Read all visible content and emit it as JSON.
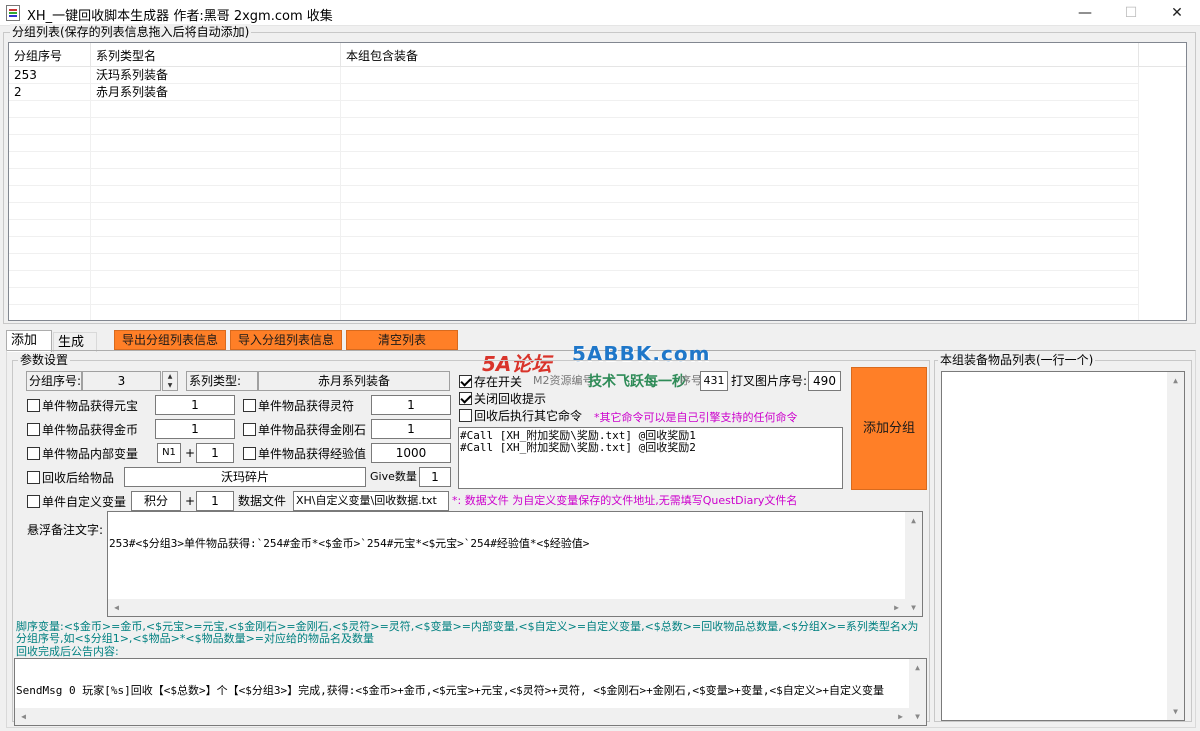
{
  "window": {
    "title": "XH_一键回收脚本生成器 作者:黑哥 2xgm.com 收集",
    "minimize": "—",
    "maximize": "☐",
    "close": "✕"
  },
  "group_list": {
    "title": "分组列表(保存的列表信息拖入后将自动添加)",
    "columns": [
      "分组序号",
      "系列类型名",
      "本组包含装备"
    ],
    "rows": [
      {
        "id": "253",
        "type": "沃玛系列装备",
        "items": ""
      },
      {
        "id": "2",
        "type": "赤月系列装备",
        "items": ""
      }
    ]
  },
  "tabs": [
    {
      "label": "添加"
    },
    {
      "label": "生成"
    }
  ],
  "toolbar": {
    "export": "导出分组列表信息",
    "import": "导入分组列表信息",
    "clear": "清空列表"
  },
  "watermark": {
    "logo": "5A论坛",
    "domain": "5ABBK.com",
    "slogan": "技术飞跃每一秒"
  },
  "params": {
    "title": "参数设置",
    "group_no_label": "分组序号:",
    "group_no_value": "3",
    "series_type_label": "系列类型:",
    "series_type_value": "赤月系列装备",
    "yuanbao": {
      "label": "单件物品获得元宝",
      "checked": false,
      "value": "1"
    },
    "lingfu": {
      "label": "单件物品获得灵符",
      "checked": false,
      "value": "1"
    },
    "gold": {
      "label": "单件物品获得金币",
      "checked": false,
      "value": "1"
    },
    "diamond": {
      "label": "单件物品获得金刚石",
      "checked": false,
      "value": "1"
    },
    "var": {
      "label": "单件物品内部变量",
      "checked": false,
      "var_name": "N1",
      "plus": "+",
      "value": "1"
    },
    "exp": {
      "label": "单件物品获得经验值",
      "checked": false,
      "value": "1000"
    },
    "give": {
      "label": "回收后给物品",
      "checked": false,
      "item": "沃玛碎片",
      "count_label": "Give数量",
      "count": "1"
    },
    "custom": {
      "label": "单件自定义变量",
      "checked": false,
      "var_name": "积分",
      "plus": "+",
      "value": "1",
      "file_label": "数据文件",
      "file_value": "XH\\自定义变量\\回收数据.txt",
      "file_hint": "*: 数据文件 为自定义变量保存的文件地址,无需填写QuestDiary文件名"
    },
    "exist_switch": {
      "label": "存在开关",
      "checked": true,
      "extra": "M2资源编号",
      "extra2": "序号",
      "res_value": "431",
      "img_label": "打叉图片序号:",
      "img_value": "490"
    },
    "close_tip": {
      "label": "关闭回收提示",
      "checked": true
    },
    "exec_other": {
      "label": "回收后执行其它命令",
      "checked": false
    },
    "other_hint": "*其它命令可以是自己引擎支持的任何命令",
    "commands": "#Call [XH_附加奖励\\奖励.txt] @回收奖励1\n#Call [XH_附加奖励\\奖励.txt] @回收奖励2",
    "add_group": "添加分组",
    "tooltip_label": "悬浮备注文字:",
    "tooltip_text": "253#<$分组3>单件物品获得:`254#金币*<$金币>`254#元宝*<$元宝>`254#经验值*<$经验值>",
    "help_text": "脚序变量:<$金币>=金币,<$元宝>=元宝,<$金刚石>=金刚石,<$灵符>=灵符,<$变量>=内部变量,<$自定义>=自定义变量,<$总数>=回收物品总数量,<$分组X>=系列类型名x为分组序号,如<$分组1>,<$物品>*<$物品数量>=对应给的物品名及数量",
    "announce_label": "回收完成后公告内容:",
    "announce_text": "SendMsg 0 玩家[%s]回收【<$总数>】个【<$分组3>】完成,获得:<$金币>+金币,<$元宝>+元宝,<$灵符>+灵符, <$金刚石>+金刚石,<$变量>+变量,<$自定义>+自定义变量"
  },
  "item_list": {
    "title": "本组装备物品列表(一行一个)"
  }
}
